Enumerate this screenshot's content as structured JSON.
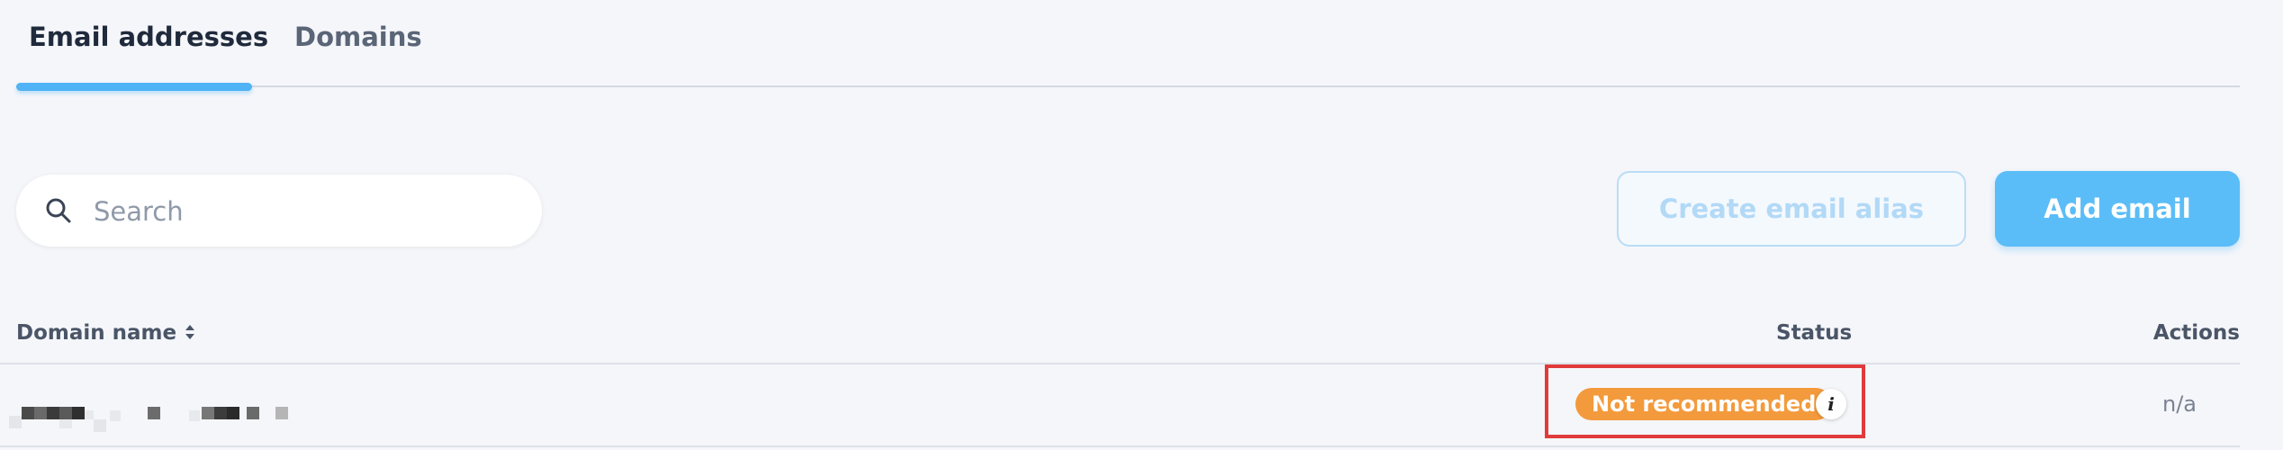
{
  "tabs": [
    {
      "label": "Email addresses",
      "active": true
    },
    {
      "label": "Domains",
      "active": false
    }
  ],
  "search": {
    "placeholder": "Search",
    "value": "",
    "icon": "search-icon"
  },
  "buttons": {
    "create_alias": "Create email alias",
    "add_email": "Add email"
  },
  "table": {
    "columns": {
      "domain": "Domain name",
      "status": "Status",
      "actions": "Actions"
    },
    "sort_icon": "sort-icon",
    "rows": [
      {
        "domain": "",
        "status": "Not recommended",
        "status_color": "#f39a3c",
        "info_icon": "info-icon",
        "info_glyph": "i",
        "actions": "n/a"
      }
    ]
  },
  "colors": {
    "accent": "#4fb3f6",
    "primary_button": "#5bbdf7",
    "highlight": "#e03b3b",
    "background": "#f5f6fa"
  }
}
